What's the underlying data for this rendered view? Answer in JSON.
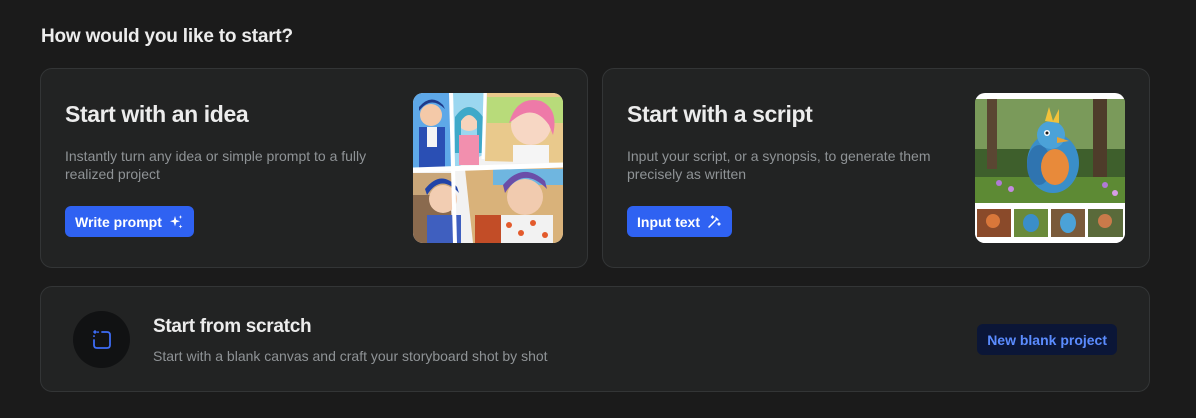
{
  "heading": "How would you like to start?",
  "idea_card": {
    "title": "Start with an idea",
    "description": "Instantly turn any idea or simple prompt to a fully realized project",
    "button_label": "Write prompt",
    "button_icon": "sparkles-icon"
  },
  "script_card": {
    "title": "Start with a script",
    "description": "Input your script, or a synopsis, to generate them precisely as written",
    "button_label": "Input text",
    "button_icon": "magic-wand-icon"
  },
  "scratch_card": {
    "title": "Start from scratch",
    "description": "Start with a blank canvas and craft your storyboard shot by shot",
    "button_label": "New blank project",
    "icon": "blank-canvas-icon"
  },
  "colors": {
    "background": "#1b1b1b",
    "card": "#222323",
    "accent": "#2f62f2",
    "muted_text": "#8f9396",
    "blank_button_bg": "#0b1637",
    "blank_button_text": "#5b8cff"
  }
}
